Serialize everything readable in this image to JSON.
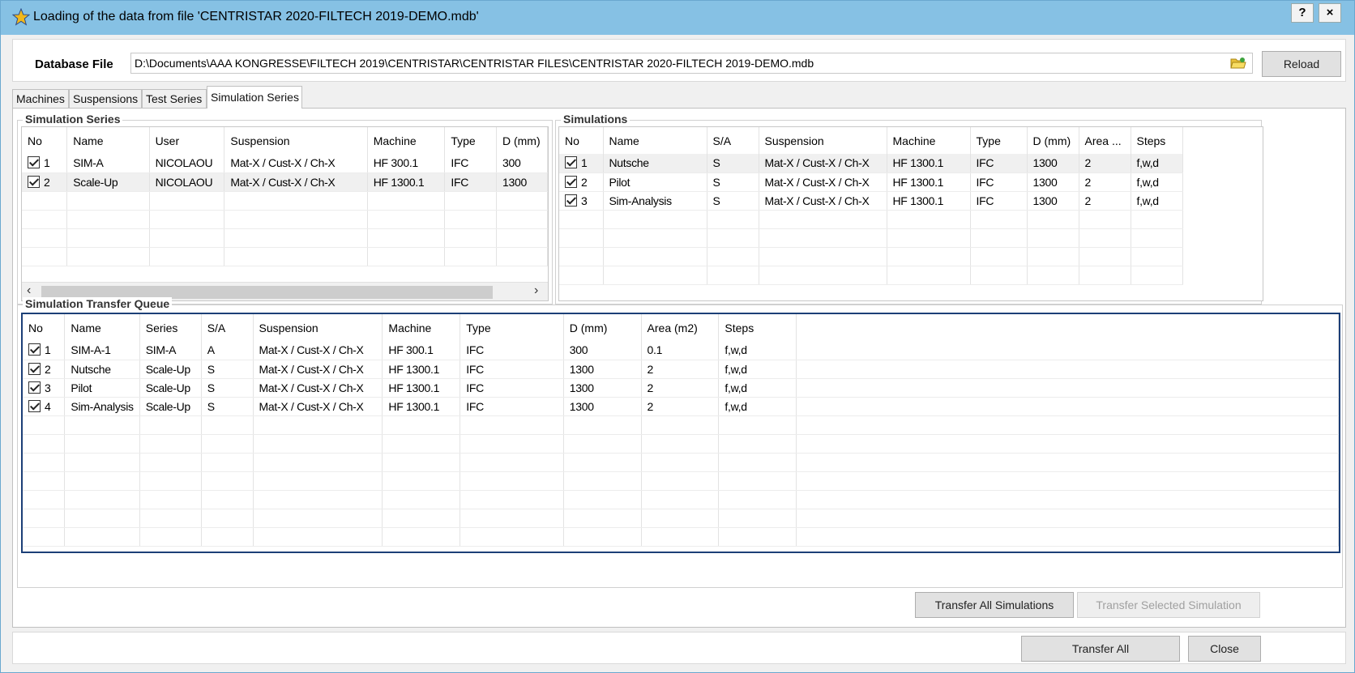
{
  "window": {
    "title": "Loading of the data from file 'CENTRISTAR 2020-FILTECH 2019-DEMO.mdb'",
    "help_label": "?",
    "close_label": "×"
  },
  "database": {
    "label": "Database File",
    "path": "D:\\Documents\\AAA KONGRESSE\\FILTECH 2019\\CENTRISTAR\\CENTRISTAR FILES\\CENTRISTAR 2020-FILTECH 2019-DEMO.mdb",
    "reload_label": "Reload"
  },
  "tabs": [
    "Machines",
    "Suspensions",
    "Test Series",
    "Simulation Series"
  ],
  "active_tab": "Simulation Series",
  "simulation_series": {
    "title": "Simulation Series",
    "columns": [
      "No",
      "Name",
      "User",
      "Suspension",
      "Machine",
      "Type",
      "D (mm)"
    ],
    "rows": [
      [
        "1",
        "SIM-A",
        "NICOLAOU",
        "Mat-X / Cust-X / Ch-X",
        "HF 300.1",
        "IFC",
        "300"
      ],
      [
        "2",
        "Scale-Up",
        "NICOLAOU",
        "Mat-X / Cust-X / Ch-X",
        "HF 1300.1",
        "IFC",
        "1300"
      ]
    ],
    "selected_row": 2
  },
  "simulations": {
    "title": "Simulations",
    "columns": [
      "No",
      "Name",
      "S/A",
      "Suspension",
      "Machine",
      "Type",
      "D (mm)",
      "Area ...",
      "Steps"
    ],
    "rows": [
      [
        "1",
        "Nutsche",
        "S",
        "Mat-X / Cust-X / Ch-X",
        "HF 1300.1",
        "IFC",
        "1300",
        "2",
        "f,w,d"
      ],
      [
        "2",
        "Pilot",
        "S",
        "Mat-X / Cust-X / Ch-X",
        "HF 1300.1",
        "IFC",
        "1300",
        "2",
        "f,w,d"
      ],
      [
        "3",
        "Sim-Analysis",
        "S",
        "Mat-X / Cust-X / Ch-X",
        "HF 1300.1",
        "IFC",
        "1300",
        "2",
        "f,w,d"
      ]
    ],
    "selected_row": 1
  },
  "transfer_queue": {
    "title": "Simulation Transfer Queue",
    "columns": [
      "No",
      "Name",
      "Series",
      "S/A",
      "Suspension",
      "Machine",
      "Type",
      "D (mm)",
      "Area (m2)",
      "Steps"
    ],
    "rows": [
      [
        "1",
        "SIM-A-1",
        "SIM-A",
        "A",
        "Mat-X / Cust-X / Ch-X",
        "HF 300.1",
        "IFC",
        "300",
        "0.1",
        "f,w,d"
      ],
      [
        "2",
        "Nutsche",
        "Scale-Up",
        "S",
        "Mat-X / Cust-X / Ch-X",
        "HF 1300.1",
        "IFC",
        "1300",
        "2",
        "f,w,d"
      ],
      [
        "3",
        "Pilot",
        "Scale-Up",
        "S",
        "Mat-X / Cust-X / Ch-X",
        "HF 1300.1",
        "IFC",
        "1300",
        "2",
        "f,w,d"
      ],
      [
        "4",
        "Sim-Analysis",
        "Scale-Up",
        "S",
        "Mat-X / Cust-X / Ch-X",
        "HF 1300.1",
        "IFC",
        "1300",
        "2",
        "f,w,d"
      ]
    ]
  },
  "buttons": {
    "transfer_all_simulations": "Transfer All Simulations",
    "transfer_selected_simulation": "Transfer Selected Simulation",
    "transfer_all": "Transfer All",
    "close": "Close"
  },
  "icons": {
    "title_icon": "star-icon",
    "folder_icon": "folder-open-icon",
    "scroll_left": "‹",
    "scroll_right": "›"
  },
  "colors": {
    "titlebar": "#86c1e4",
    "focus_border": "#1c3f77",
    "star": "#f2b81b"
  }
}
